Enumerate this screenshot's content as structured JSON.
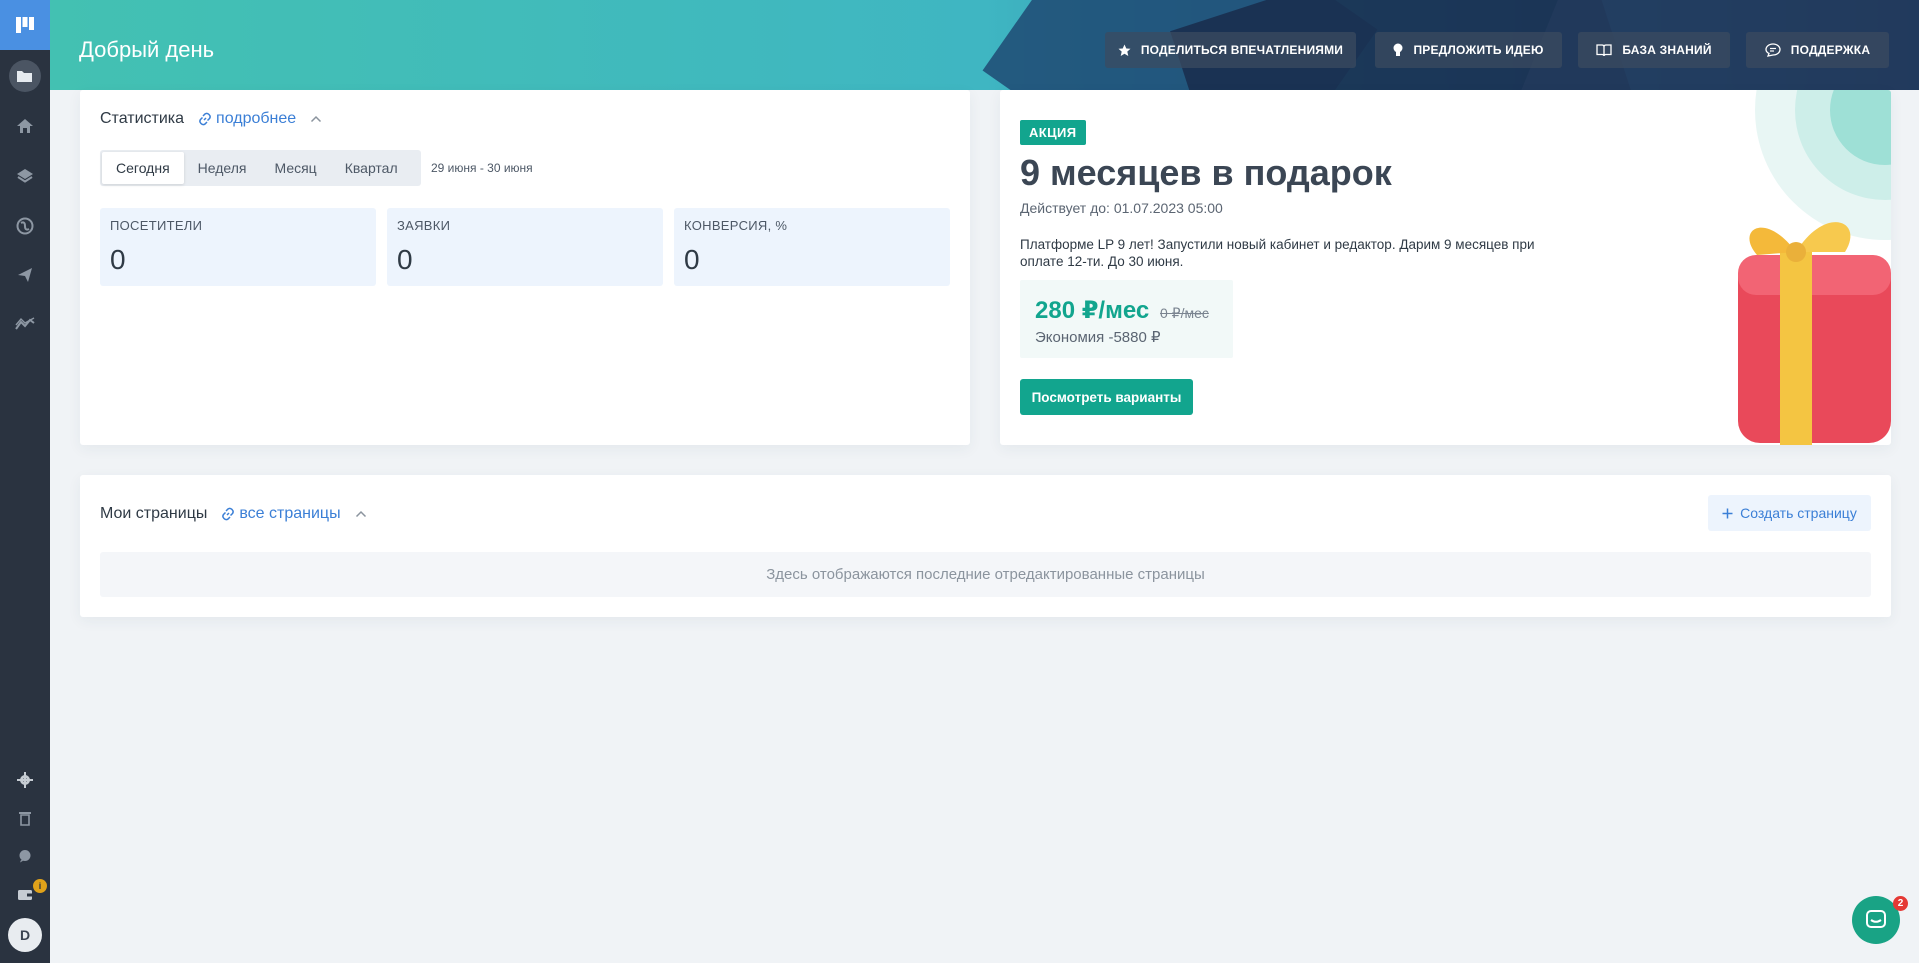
{
  "sidebar": {
    "items": [
      {
        "icon": "folder-icon",
        "active": true
      },
      {
        "icon": "home-icon"
      },
      {
        "icon": "layers-icon"
      },
      {
        "icon": "globe-icon"
      },
      {
        "icon": "send-icon"
      },
      {
        "icon": "analytics-icon"
      }
    ],
    "bottom": [
      {
        "icon": "gear-icon"
      },
      {
        "icon": "trash-icon"
      },
      {
        "icon": "chat-bubble-icon"
      },
      {
        "icon": "wallet-icon",
        "badge": "i"
      }
    ],
    "avatar_letter": "D"
  },
  "header": {
    "greeting": "Добрый день",
    "buttons": [
      {
        "label": "ПОДЕЛИТЬСЯ ВПЕЧАТЛЕНИЯМИ",
        "icon": "star-icon"
      },
      {
        "label": "ПРЕДЛОЖИТЬ ИДЕЮ",
        "icon": "lightbulb-icon"
      },
      {
        "label": "БАЗА ЗНАНИЙ",
        "icon": "book-icon"
      },
      {
        "label": "ПОДДЕРЖКА",
        "icon": "chat-icon"
      }
    ]
  },
  "stats": {
    "title": "Статистика",
    "link": "подробнее",
    "tabs": [
      "Сегодня",
      "Неделя",
      "Месяц",
      "Квартал"
    ],
    "active_tab": "Сегодня",
    "date_range": "29 июня - 30 июня",
    "metrics": [
      {
        "label": "ПОСЕТИТЕЛИ",
        "value": "0"
      },
      {
        "label": "ЗАЯВКИ",
        "value": "0"
      },
      {
        "label": "КОНВЕРСИЯ, %",
        "value": "0"
      }
    ]
  },
  "promo": {
    "tag": "АКЦИЯ",
    "title": "9 месяцев в подарок",
    "valid_until": "Действует до: 01.07.2023 05:00",
    "description": "Платформе LP 9 лет! Запустили новый кабинет и редактор. Дарим 9 месяцев при оплате 12-ти. До 30 июня.",
    "price": "280 ₽/мес",
    "old_price": "0 ₽/мес",
    "savings": "Экономия -5880 ₽",
    "button": "Посмотреть варианты"
  },
  "pages": {
    "title": "Мои страницы",
    "link": "все страницы",
    "create_button": "Создать страницу",
    "empty_text": "Здесь отображаются последние отредактированные страницы"
  },
  "chat_widget": {
    "badge": "2"
  },
  "colors": {
    "accent": "#12a58e",
    "link": "#3b7fd6",
    "sidebar": "#2a3340",
    "metric_bg": "#edf4fd"
  }
}
